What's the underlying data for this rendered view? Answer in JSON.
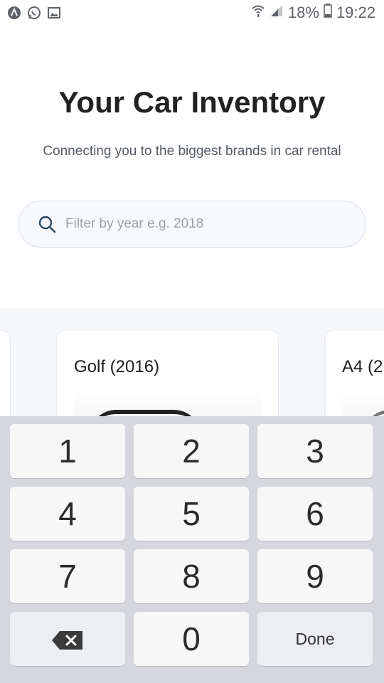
{
  "status_bar": {
    "battery": "18%",
    "time": "19:22",
    "left_icons": [
      "app-icon",
      "whatsapp-icon",
      "gallery-icon"
    ],
    "right_icons": [
      "wifi-icon",
      "signal-icon",
      "battery-icon"
    ]
  },
  "header": {
    "title": "Your Car Inventory",
    "subtitle": "Connecting you to the biggest brands in car rental"
  },
  "search": {
    "placeholder": "Filter by year e.g. 2018",
    "value": ""
  },
  "cards": [
    {
      "title": ""
    },
    {
      "title": "Golf (2016)"
    },
    {
      "title": "A4 (2"
    }
  ],
  "keyboard": {
    "keys": [
      "1",
      "2",
      "3",
      "4",
      "5",
      "6",
      "7",
      "8",
      "9",
      "",
      "0",
      "Done"
    ]
  }
}
